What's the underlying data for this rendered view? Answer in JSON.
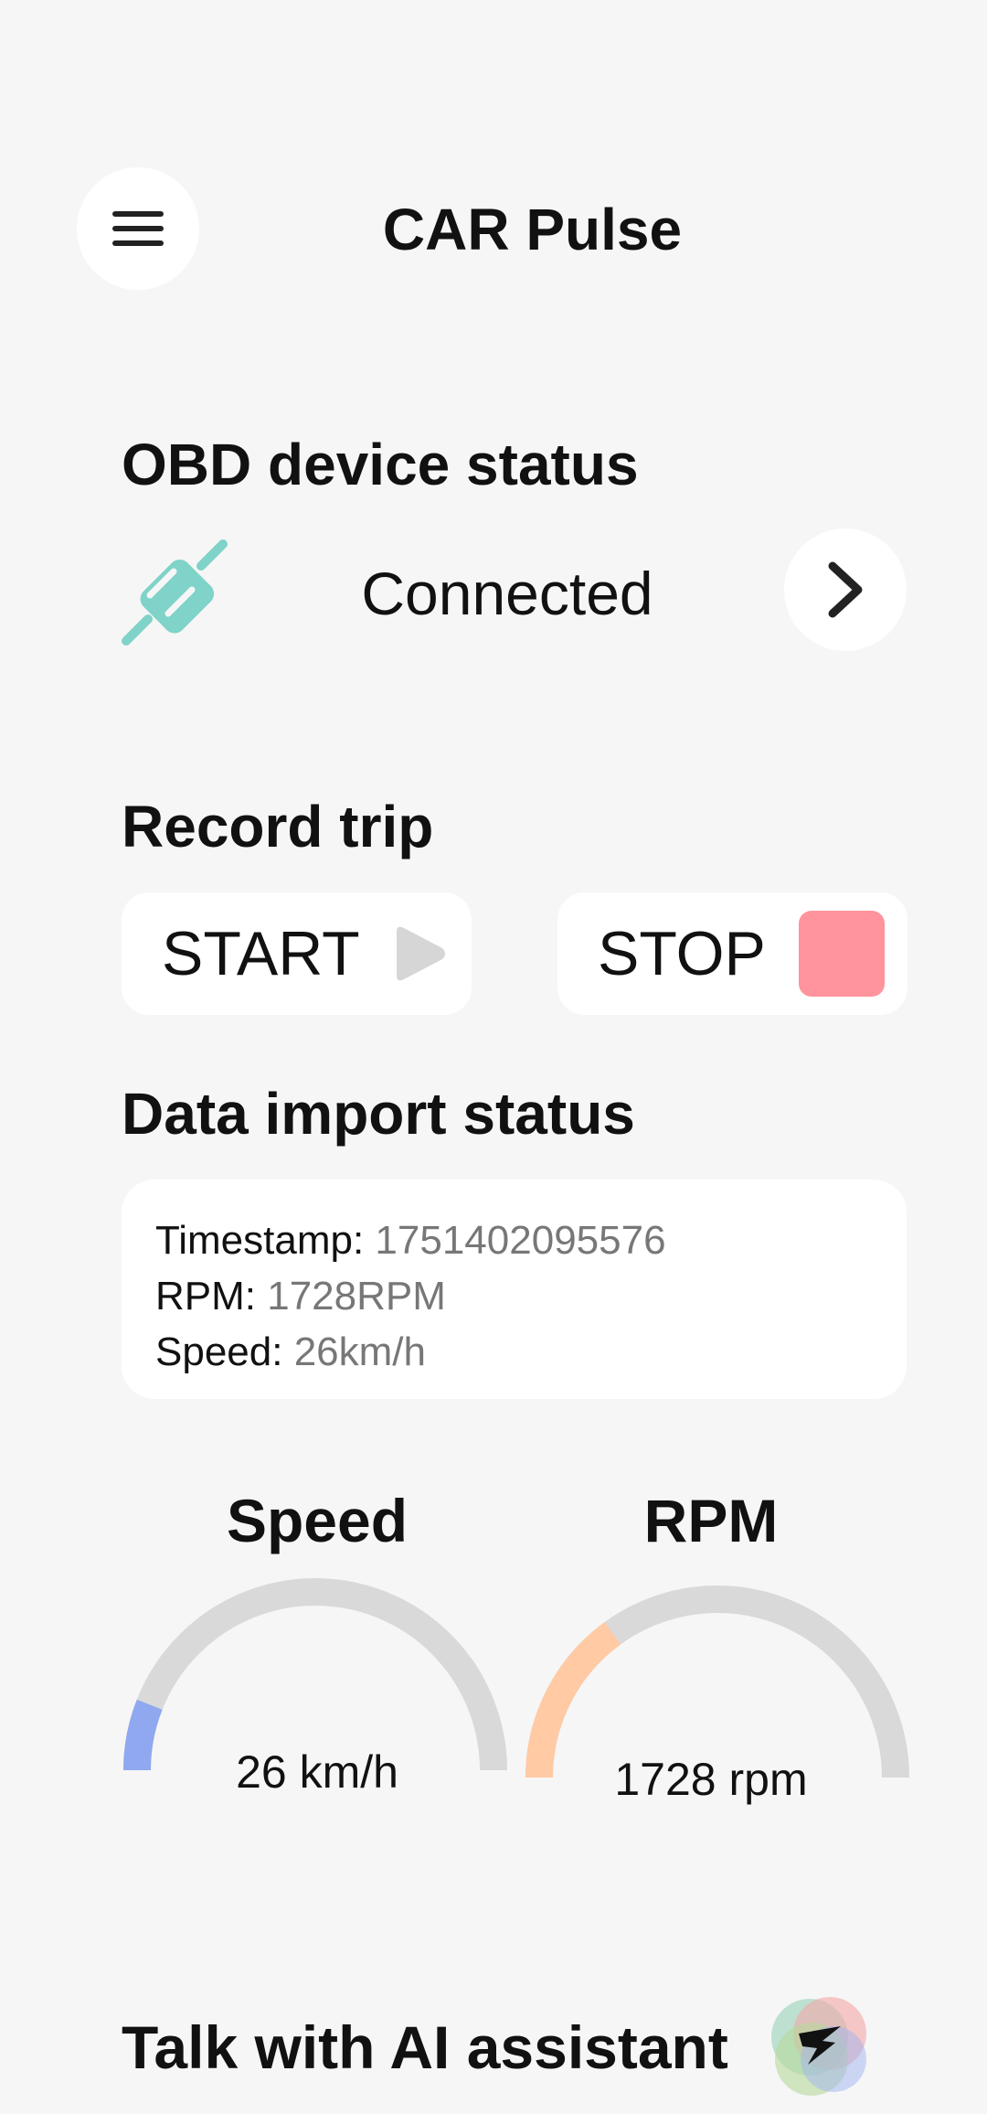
{
  "header": {
    "title": "CAR Pulse",
    "menu_icon": "hamburger-menu-icon"
  },
  "obd": {
    "section_title": "OBD device status",
    "status": "Connected",
    "plug_icon": "plug-icon",
    "plug_color": "#7fd3c8",
    "details_icon": "chevron-right-icon"
  },
  "trip": {
    "section_title": "Record trip",
    "start_label": "START",
    "start_icon": "play-icon",
    "stop_label": "STOP",
    "stop_icon": "stop-icon",
    "stop_color": "#ff949c"
  },
  "import": {
    "section_title": "Data import status",
    "timestamp_label": "Timestamp: ",
    "timestamp_value": "1751402095576",
    "rpm_label": "RPM: ",
    "rpm_value": "1728RPM",
    "speed_label": "Speed: ",
    "speed_value": "26km/h"
  },
  "gauges": {
    "speed": {
      "title": "Speed",
      "value_text": "26 km/h",
      "fill_fraction": 0.12,
      "color": "#8fa8ef"
    },
    "rpm": {
      "title": "RPM",
      "value_text": "1728 rpm",
      "fill_fraction": 0.3,
      "color": "#ffcaa4"
    },
    "track_color": "#d9d9d9"
  },
  "assistant": {
    "title": "Talk with AI assistant",
    "icon": "ai-assistant-orb-icon"
  }
}
